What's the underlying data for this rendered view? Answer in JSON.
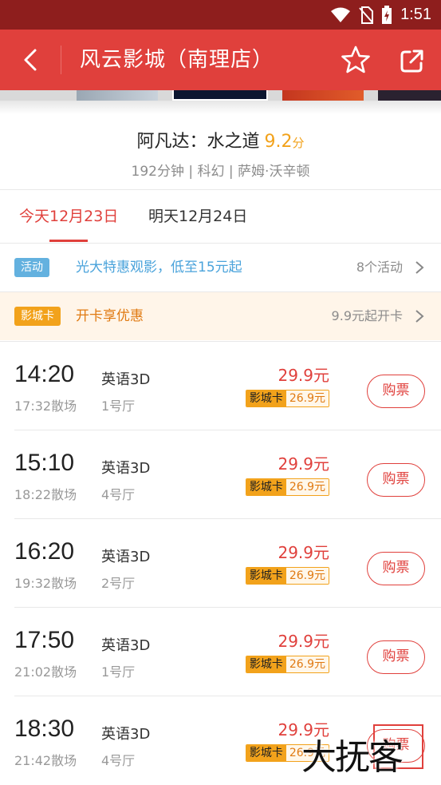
{
  "status_bar": {
    "time": "1:51"
  },
  "header": {
    "title": "风云影城（南理店）"
  },
  "movie": {
    "name": "阿凡达：水之道",
    "score": "9.2",
    "score_unit": "分",
    "meta": "192分钟 | 科幻 | 萨姆·沃辛顿"
  },
  "date_tabs": [
    {
      "label": "今天12月23日",
      "active": true
    },
    {
      "label": "明天12月24日",
      "active": false
    }
  ],
  "promos": {
    "events": {
      "tag": "活动",
      "text": "光大特惠观影，低至15元起",
      "right": "8个活动"
    },
    "card": {
      "tag": "影城卡",
      "text": "开卡享优惠",
      "right": "9.9元起开卡"
    }
  },
  "showtimes": [
    {
      "start": "14:20",
      "end": "17:32散场",
      "lang": "英语3D",
      "hall": "1号厅",
      "price": "29.9元",
      "card_label": "影城卡",
      "card_price": "26.9元",
      "button": "购票"
    },
    {
      "start": "15:10",
      "end": "18:22散场",
      "lang": "英语3D",
      "hall": "4号厅",
      "price": "29.9元",
      "card_label": "影城卡",
      "card_price": "26.9元",
      "button": "购票"
    },
    {
      "start": "16:20",
      "end": "19:32散场",
      "lang": "英语3D",
      "hall": "2号厅",
      "price": "29.9元",
      "card_label": "影城卡",
      "card_price": "26.9元",
      "button": "购票"
    },
    {
      "start": "17:50",
      "end": "21:02散场",
      "lang": "英语3D",
      "hall": "1号厅",
      "price": "29.9元",
      "card_label": "影城卡",
      "card_price": "26.9元",
      "button": "购票"
    },
    {
      "start": "18:30",
      "end": "21:42散场",
      "lang": "英语3D",
      "hall": "4号厅",
      "price": "29.9元",
      "card_label": "影城卡",
      "card_price": "26.9元",
      "button": "购票"
    }
  ],
  "watermark": "大抚客",
  "colors": {
    "brand_red": "#e0403c",
    "status_bar": "#8e1e1d",
    "score_orange": "#f2a21b",
    "event_blue": "#4aa3db"
  }
}
